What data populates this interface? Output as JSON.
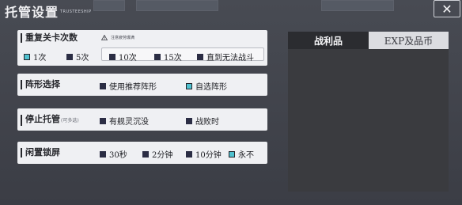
{
  "dialog": {
    "title": "托管设置",
    "subtitle": "TRUSTEESHIP",
    "close_icon": "close-x-icon"
  },
  "settings": {
    "repeat": {
      "label": "重复关卡次数",
      "warning": "注意疲劳爆满",
      "options": [
        {
          "label": "1次",
          "selected": true
        },
        {
          "label": "5次",
          "selected": false
        },
        {
          "label": "10次",
          "selected": false
        },
        {
          "label": "15次",
          "selected": false
        },
        {
          "label": "直到无法战斗",
          "selected": false
        }
      ]
    },
    "formation": {
      "label": "阵形选择",
      "options": [
        {
          "label": "使用推荐阵形",
          "selected": false
        },
        {
          "label": "自选阵形",
          "selected": true
        }
      ]
    },
    "stop": {
      "label": "停止托管",
      "hint": "(可多选)",
      "options": [
        {
          "label": "有舰灵沉没",
          "selected": false
        },
        {
          "label": "战败时",
          "selected": false
        }
      ]
    },
    "idle": {
      "label": "闲置锁屏",
      "options": [
        {
          "label": "30秒",
          "selected": false
        },
        {
          "label": "2分钟",
          "selected": false
        },
        {
          "label": "10分钟",
          "selected": false
        },
        {
          "label": "永不",
          "selected": true
        }
      ]
    }
  },
  "rewards": {
    "tabs": [
      {
        "label": "战利品",
        "active": true
      },
      {
        "label": "EXP及品币",
        "active": false
      }
    ]
  },
  "colors": {
    "accent": "#4fc1cf",
    "checkbox": "#2b2d44",
    "card": "#eff0f3",
    "panel_dark": "#3a3b3f"
  }
}
